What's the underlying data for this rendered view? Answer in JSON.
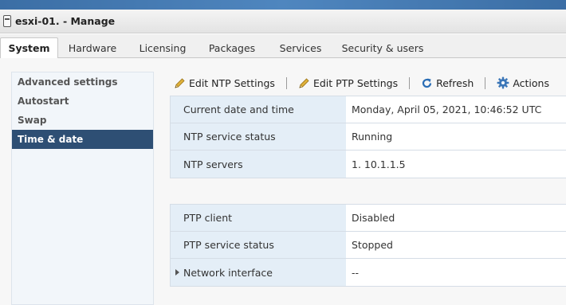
{
  "window": {
    "title": "esxi-01. - Manage",
    "icon": "host-icon"
  },
  "tabs": [
    {
      "label": "System",
      "active": true
    },
    {
      "label": "Hardware",
      "active": false
    },
    {
      "label": "Licensing",
      "active": false
    },
    {
      "label": "Packages",
      "active": false
    },
    {
      "label": "Services",
      "active": false
    },
    {
      "label": "Security & users",
      "active": false
    }
  ],
  "sidebar": {
    "items": [
      {
        "label": "Advanced settings",
        "selected": false
      },
      {
        "label": "Autostart",
        "selected": false
      },
      {
        "label": "Swap",
        "selected": false
      },
      {
        "label": "Time & date",
        "selected": true
      }
    ]
  },
  "toolbar": {
    "edit_ntp": "Edit NTP Settings",
    "edit_ptp": "Edit PTP Settings",
    "refresh": "Refresh",
    "actions": "Actions"
  },
  "ntp": {
    "current_date_label": "Current date and time",
    "current_date_value": "Monday, April 05, 2021, 10:46:52 UTC",
    "service_status_label": "NTP service status",
    "service_status_value": "Running",
    "servers_label": "NTP servers",
    "servers_value": "1. 10.1.1.5"
  },
  "ptp": {
    "client_label": "PTP client",
    "client_value": "Disabled",
    "service_status_label": "PTP service status",
    "service_status_value": "Stopped",
    "network_interface_label": "Network interface",
    "network_interface_value": "--"
  },
  "colors": {
    "selected_nav": "#2e4f74",
    "label_cell_bg": "#e4eef7",
    "refresh_icon": "#2a6db5",
    "gear_icon": "#3c77b8",
    "pencil_icon": "#d8a21c"
  }
}
